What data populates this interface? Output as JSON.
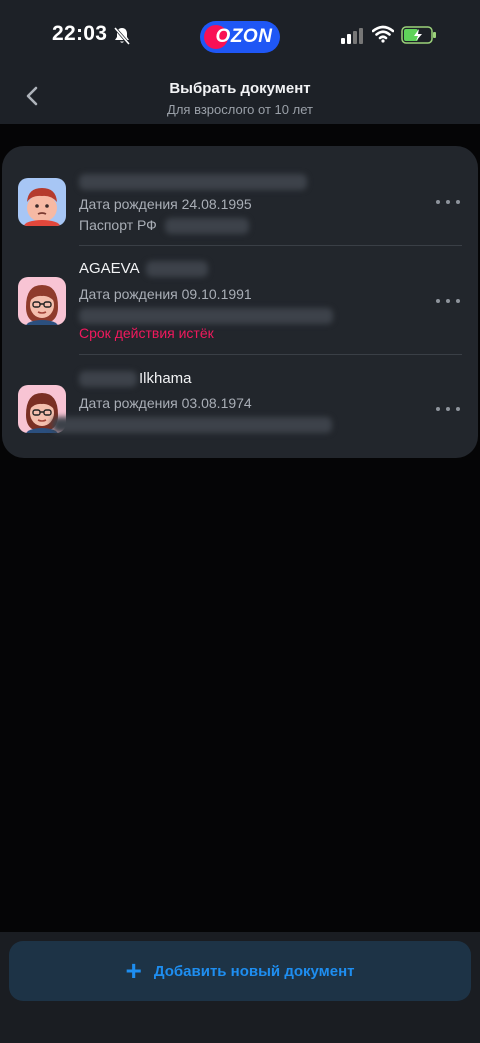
{
  "status_bar": {
    "time": "22:03",
    "logo_text": "OZON",
    "brand_color": "#1f57f5",
    "brand_accent": "#f91155"
  },
  "header": {
    "title": "Выбрать документ",
    "subtitle": "Для взрослого от 10 лет"
  },
  "documents": [
    {
      "name": "",
      "birth": "Дата рождения 24.08.1995",
      "doc_type": "Паспорт РФ",
      "avatar": "boy-avatar-icon"
    },
    {
      "name": "AGAEVA",
      "birth": "Дата рождения 09.10.1991",
      "status": "Срок действия истёк",
      "avatar": "woman-avatar-icon"
    },
    {
      "name": "Ilkhama",
      "birth": "Дата рождения 03.08.1974",
      "avatar": "woman-avatar-icon"
    }
  ],
  "actions": {
    "add_label": "Добавить новый документ"
  },
  "colors": {
    "accent": "#1e8ef0",
    "expired": "#f0195d",
    "card": "#22262c"
  }
}
